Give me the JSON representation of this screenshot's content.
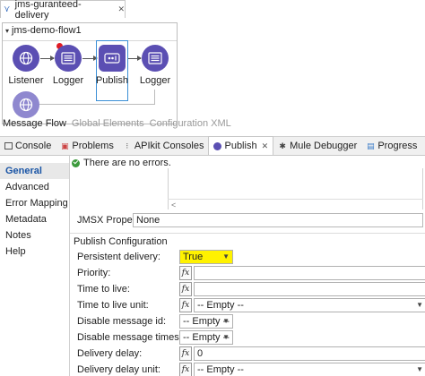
{
  "editor": {
    "tab_title": "jms-guranteed-delivery"
  },
  "flow": {
    "name": "jms-demo-flow1",
    "nodes": [
      {
        "label": "Listener"
      },
      {
        "label": "Logger"
      },
      {
        "label": "Publish"
      },
      {
        "label": "Logger"
      }
    ]
  },
  "canvas_tabs": [
    "Message Flow",
    "Global Elements",
    "Configuration XML"
  ],
  "view_tabs": [
    {
      "label": "Console",
      "icon": "console-icon"
    },
    {
      "label": "Problems",
      "icon": "problems-icon"
    },
    {
      "label": "APIkit Consoles",
      "icon": "apikit-icon"
    },
    {
      "label": "Publish",
      "icon": "publish-icon"
    },
    {
      "label": "Mule Debugger",
      "icon": "debugger-icon"
    },
    {
      "label": "Progress",
      "icon": "progress-icon"
    }
  ],
  "sidebar": [
    "General",
    "Advanced",
    "Error Mapping",
    "Metadata",
    "Notes",
    "Help"
  ],
  "status": "There are no errors.",
  "jmsx": {
    "label": "JMSX Properties",
    "value": "None"
  },
  "publish_config": {
    "title": "Publish Configuration",
    "persistent_delivery": {
      "label": "Persistent delivery:",
      "value": "True"
    },
    "priority": {
      "label": "Priority:"
    },
    "time_to_live": {
      "label": "Time to live:"
    },
    "time_to_live_unit": {
      "label": "Time to live unit:",
      "value": "-- Empty --"
    },
    "disable_message_id": {
      "label": "Disable message id:",
      "value": "-- Empty --"
    },
    "disable_message_timestamp": {
      "label": "Disable message timestamp:",
      "value": "-- Empty --"
    },
    "delivery_delay": {
      "label": "Delivery delay:",
      "value": "0"
    },
    "delivery_delay_unit": {
      "label": "Delivery delay unit:",
      "value": "-- Empty --"
    }
  },
  "colors": {
    "node": "#5b4fb3",
    "selection": "#3b8fd6",
    "highlight": "#fff200",
    "active_side": "#1a55a6"
  }
}
